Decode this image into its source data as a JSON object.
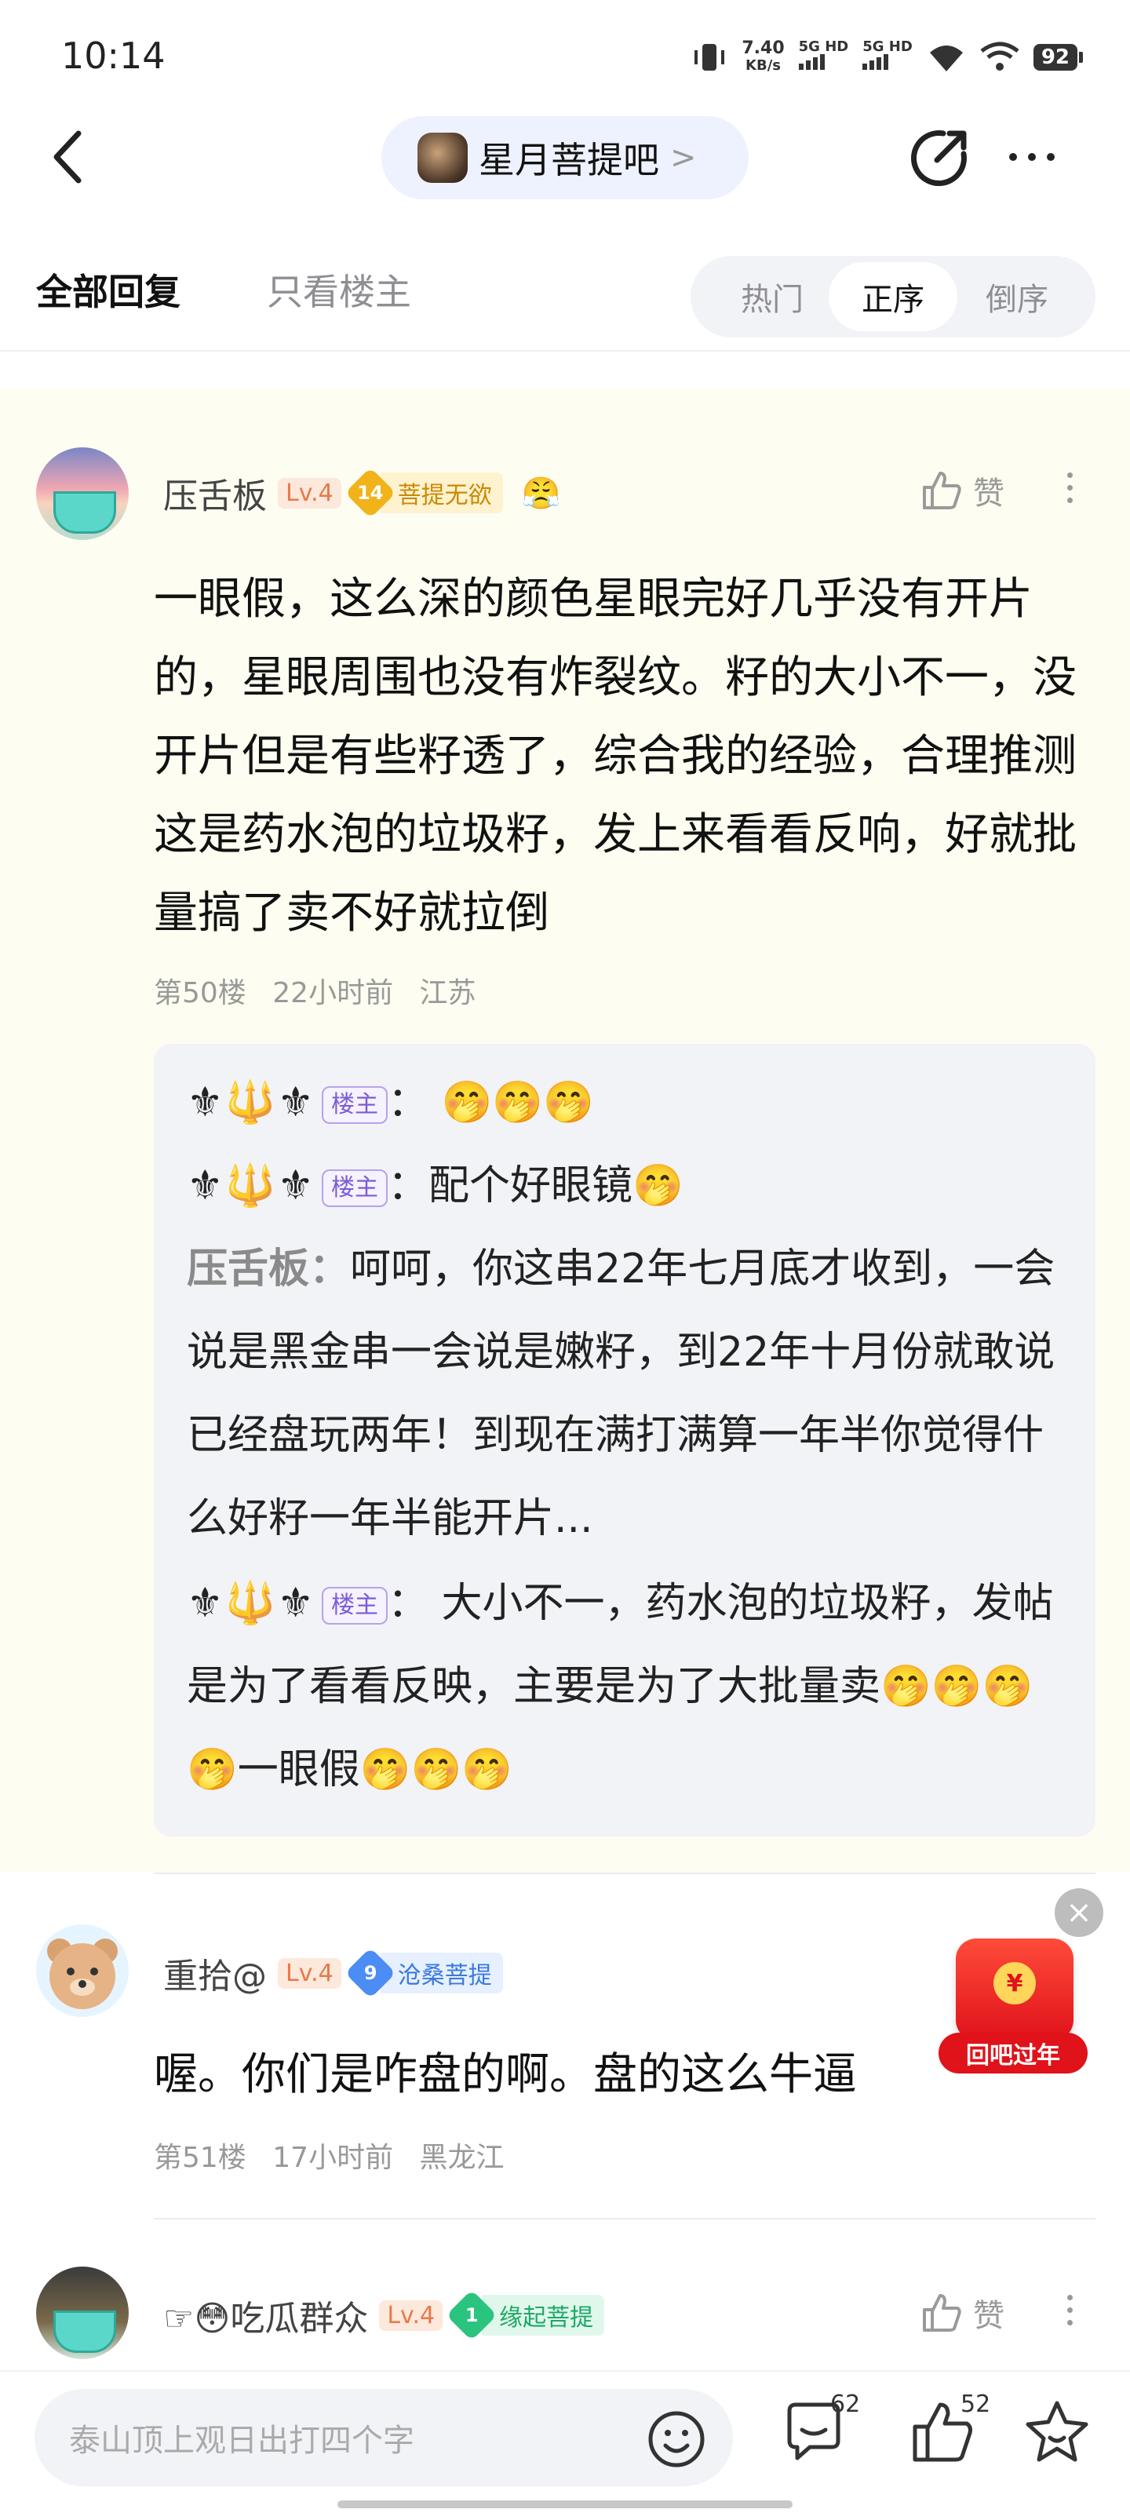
{
  "status_bar": {
    "time": "10:14",
    "speed_value": "7.40",
    "speed_unit": "KB/s",
    "net1": "5G HD",
    "net2": "5G HD",
    "battery": "92"
  },
  "nav": {
    "forum_name": "星月菩提吧",
    "forum_arrow": ">"
  },
  "tabs": {
    "all_replies": "全部回复",
    "op_only": "只看楼主",
    "sort_hot": "热门",
    "sort_asc": "正序",
    "sort_desc": "倒序"
  },
  "replies": [
    {
      "username": "压舌板",
      "level": "Lv.4",
      "badge_num": "14",
      "badge_name": "菩提无欲",
      "extra_badge": "😤",
      "like_label": "赞",
      "content": "一眼假，这么深的颜色星眼完好几乎没有开片的，星眼周围也没有炸裂纹。籽的大小不一，没开片但是有些籽透了，综合我的经验，合理推测这是药水泡的垃圾籽，发上来看看反响，好就批量搞了卖不好就拉倒",
      "floor": "第50楼",
      "time": "22小时前",
      "location": "江苏",
      "sub_replies": [
        {
          "author": "⚜🔱⚜",
          "tag": "楼主",
          "sep": "：",
          "text": "🤭🤭🤭"
        },
        {
          "author": "⚜🔱⚜",
          "tag": "楼主",
          "sep": "：",
          "text": "配个好眼镜🤭"
        },
        {
          "author": "压舌板",
          "tag": "",
          "sep": "：",
          "text": "呵呵，你这串22年七月底才收到，一会说是黑金串一会说是嫩籽，到22年十月份就敢说已经盘玩两年！到现在满打满算一年半你觉得什么好籽一年半能开片..."
        },
        {
          "author": "⚜🔱⚜",
          "tag": "楼主",
          "sep": "：",
          "text": " 大小不一，药水泡的垃圾籽，发帖是为了看看反映，主要是为了大批量卖🤭🤭🤭🤭一眼假🤭🤭🤭"
        }
      ]
    },
    {
      "username": "重拾@",
      "level": "Lv.4",
      "badge_num": "9",
      "badge_name": "沧桑菩提",
      "content": "喔。你们是咋盘的啊。盘的这么牛逼",
      "floor": "第51楼",
      "time": "17小时前",
      "location": "黑龙江"
    },
    {
      "username": "☞😳吃瓜群众",
      "level": "Lv.4",
      "badge_num": "1",
      "badge_name": "缘起菩提",
      "like_label": "赞"
    }
  ],
  "red_packet": {
    "label": "回吧过年",
    "close": "×"
  },
  "bottom_bar": {
    "input_placeholder": "泰山顶上观日出打四个字",
    "comment_count": "62",
    "like_count": "52"
  }
}
